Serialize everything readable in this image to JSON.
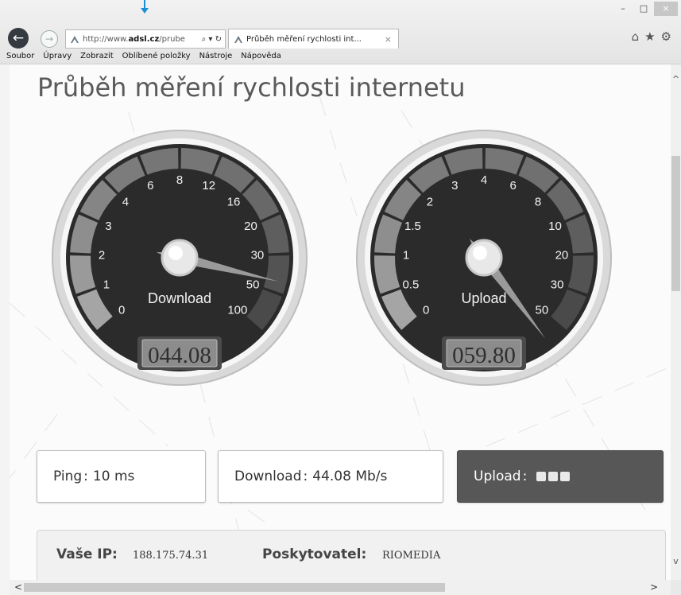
{
  "browser": {
    "address": {
      "prefix": "http://www.",
      "domain": "adsl.cz",
      "suffix": "/prube",
      "controls": "⌕ ▾ ↻"
    },
    "tab": {
      "title": "Průběh měření rychlosti int...",
      "close": "×"
    },
    "window": {
      "minimize": "–",
      "maximize": "□",
      "close": "×"
    },
    "tools": {
      "home": "⌂",
      "favorites": "★",
      "settings": "⚙"
    },
    "nav": {
      "back": "←",
      "forward": "→"
    },
    "menu": [
      "Soubor",
      "Úpravy",
      "Zobrazit",
      "Oblíbené položky",
      "Nástroje",
      "Nápověda"
    ]
  },
  "page": {
    "title": "Průběh měření rychlosti internetu",
    "gauges": [
      {
        "label": "Download",
        "readout": "044.08",
        "needle_value": 44.08,
        "ticks": [
          "0",
          "1",
          "2",
          "3",
          "4",
          "6",
          "8",
          "12",
          "16",
          "20",
          "30",
          "50",
          "100"
        ]
      },
      {
        "label": "Upload",
        "readout": "059.80",
        "needle_value": 59.8,
        "ticks": [
          "0",
          "0.5",
          "1",
          "1.5",
          "2",
          "3",
          "4",
          "6",
          "8",
          "10",
          "20",
          "30",
          "50"
        ]
      }
    ],
    "cards": {
      "ping": {
        "label": "Ping",
        "sep": ":",
        "value": "10 ms"
      },
      "download": {
        "label": "Download",
        "sep": ":",
        "value": "44.08 Mb/s"
      },
      "upload": {
        "label": "Upload",
        "sep": ":"
      }
    },
    "info": {
      "ip_label": "Vaše IP:",
      "ip_value": "188.175.74.31",
      "isp_label": "Poskytovatel:",
      "isp_value": "RIOMEDIA"
    }
  },
  "scroll": {
    "up": "^",
    "down": "v",
    "left": "<",
    "right": ">"
  },
  "colors": {
    "accent": "#1b8fd6",
    "dark_card": "#575757",
    "back_button": "#343a40"
  }
}
